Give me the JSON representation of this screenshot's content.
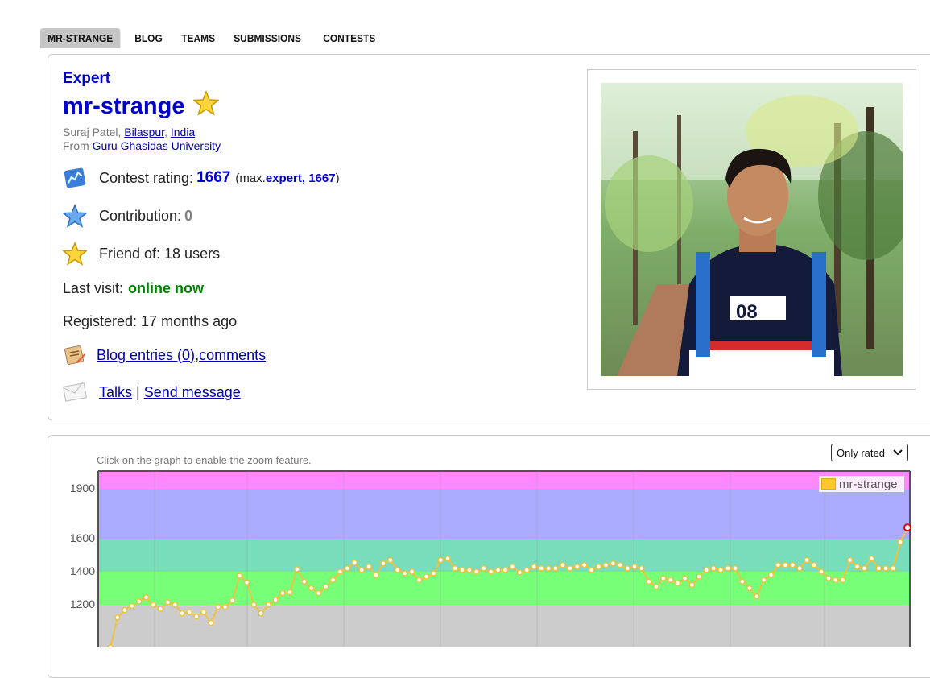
{
  "tabs": [
    "MR-STRANGE",
    "BLOG",
    "TEAMS",
    "SUBMISSIONS",
    "CONTESTS"
  ],
  "profile": {
    "rank": "Expert",
    "handle": "mr-strange",
    "name_prefix": "Suraj Patel, ",
    "city": "Bilaspur",
    "sep": ", ",
    "country": "India",
    "from_label": "From ",
    "university": "Guru Ghasidas University",
    "rating_label": "Contest rating: ",
    "rating": "1667",
    "max_open": "(max. ",
    "max_value": "expert, 1667",
    "max_close": ")",
    "contribution_label": "Contribution: ",
    "contribution": "0",
    "friend_of": "Friend of: 18 users",
    "last_visit_label": "Last visit: ",
    "last_visit": "online now",
    "registered": "Registered: 17 months ago",
    "blog_entries": "Blog entries (0)",
    "comma": ", ",
    "comments": "comments",
    "talks": "Talks",
    "pipe": " | ",
    "send_message": "Send message"
  },
  "graph": {
    "hint": "Click on the graph to enable the zoom feature.",
    "select_value": "Only rated",
    "legend": "mr-strange",
    "y_ticks": [
      "1900",
      "1600",
      "1400",
      "1200"
    ]
  },
  "colors": {
    "accent_blue": "#0000cc",
    "online_green": "#008000",
    "line": "#edc240",
    "band_pink": "#ff88ff",
    "band_blue": "#aaaaff",
    "band_teal": "#77ddbb",
    "band_green": "#77ff77",
    "band_gray": "#cccccc"
  },
  "chart_data": {
    "type": "line",
    "series": [
      {
        "name": "mr-strange",
        "values": [
          1000,
          1140,
          1175,
          1195,
          1220,
          1245,
          1200,
          1180,
          1215,
          1200,
          1160,
          1165,
          1145,
          1165,
          1115,
          1190,
          1190,
          1225,
          1375,
          1335,
          1200,
          1160,
          1200,
          1230,
          1270,
          1275,
          1415,
          1340,
          1300,
          1270,
          1310,
          1350,
          1400,
          1420,
          1455,
          1410,
          1430,
          1380,
          1450,
          1470,
          1410,
          1390,
          1400,
          1350,
          1370,
          1390,
          1470,
          1480,
          1420,
          1410,
          1410,
          1400,
          1420,
          1400,
          1410,
          1410,
          1430,
          1395,
          1410,
          1430,
          1420,
          1420,
          1420,
          1440,
          1420,
          1430,
          1440,
          1410,
          1430,
          1440,
          1450,
          1440,
          1420,
          1430,
          1420,
          1340,
          1310,
          1360,
          1350,
          1330,
          1360,
          1320,
          1370,
          1410,
          1420,
          1410,
          1420,
          1420,
          1340,
          1300,
          1250,
          1350,
          1380,
          1440,
          1440,
          1440,
          1420,
          1470,
          1440,
          1400,
          1360,
          1350,
          1350,
          1470,
          1430,
          1420,
          1480,
          1420,
          1420,
          1420,
          1580,
          1667
        ]
      }
    ],
    "ylim": [
      1000,
      2000
    ],
    "y_ticks": [
      1200,
      1400,
      1600,
      1900
    ],
    "bands": [
      {
        "from": 1900,
        "to": 2000,
        "color": "#ff88ff"
      },
      {
        "from": 1600,
        "to": 1900,
        "color": "#aaaaff"
      },
      {
        "from": 1400,
        "to": 1600,
        "color": "#77ddbb"
      },
      {
        "from": 1200,
        "to": 1400,
        "color": "#77ff77"
      },
      {
        "from": 1000,
        "to": 1200,
        "color": "#cccccc"
      }
    ],
    "legend_position": "top-right",
    "grid": true
  }
}
